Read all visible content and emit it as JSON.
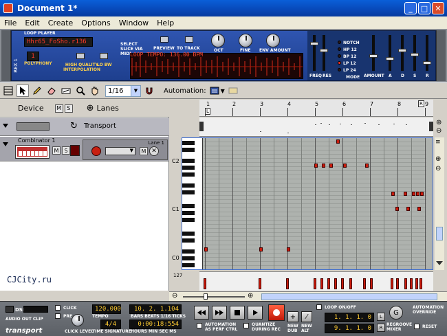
{
  "window": {
    "title": "Document 1*",
    "min_glyph": "_",
    "max_glyph": "□",
    "close_glyph": "✕"
  },
  "menu": [
    "File",
    "Edit",
    "Create",
    "Options",
    "Window",
    "Help"
  ],
  "device": {
    "header": "LOOP PLAYER",
    "patch_name": "Hhr65_FoSho.r136",
    "polyphony_label": "POLYPHONY",
    "polyphony_value": "1",
    "hq_label": "HIGH QUALITY INTERPOLATION",
    "lobw_label": "LO BW",
    "select_slice_label": "SELECT SLICE VIA MIDI",
    "preview_label": "PREVIEW",
    "to_track_label": "TO TRACK",
    "oct_label": "OCT",
    "fine_label": "FINE",
    "env_label": "ENV AMOUNT",
    "loop_tempo": "LOOP TEMPO: 136.00 BPM",
    "filter_modes": [
      "NOTCH",
      "HP 12",
      "BP 12",
      "LP 12",
      "LP 24"
    ],
    "filter_labels": [
      "FREQ",
      "RES",
      "MODE",
      "AMOUNT",
      "A",
      "D",
      "S",
      "R"
    ],
    "side_label": "REX 1"
  },
  "toolbar": {
    "quantize_value": "1/16",
    "automation_label": "Automation:"
  },
  "tracklist": {
    "device_label": "Device",
    "mute_label": "M",
    "solo_label": "S",
    "lanes_label": "Lanes",
    "transport_track": "Transport",
    "combinator_label": "Combinator 1",
    "lane_label": "Lane 1"
  },
  "ruler": [
    "1",
    "2",
    "3",
    "4",
    "5",
    "6",
    "7",
    "8",
    "9"
  ],
  "ruler_markers": {
    "left": "L",
    "right": "R"
  },
  "octaves": [
    "C2",
    "C1",
    "C0"
  ],
  "velocity_max": "127",
  "watermark": "CJCity.ru",
  "transport": {
    "dsp_label": "DSP",
    "audio_out_clip": "AUDIO OUT CLIP",
    "click_label": "CLICK",
    "pre_label": "PRE",
    "click_level_label": "CLICK LEVEL",
    "tempo_value": "120.000",
    "tempo_label": "TEMPO",
    "time_sig_value": "4/4",
    "time_sig_label": "TIME SIGNATURE",
    "bars_value": "10. 2. 1.104",
    "bars_label": "BARS BEATS 1/16 TICKS",
    "time_value": "0:00:18:554",
    "time_label": "HOURS MIN SEC MS",
    "automation_perf": "AUTOMATION AS PERF CTRL",
    "quantize_rec": "QUANTIZE DURING REC",
    "new_dub": "NEW DUB",
    "new_alt": "NEW ALT",
    "loop_label": "LOOP ON/OFF",
    "loop_left": "1. 1. 1.  0",
    "loop_right": "9. 1. 1.  0",
    "left_marker": "L",
    "right_marker": "R",
    "regroove_label": "REGROOVE MIXER",
    "automation_override": "AUTOMATION OVERRIDE",
    "reset_label": "RESET",
    "logo": "transport"
  }
}
